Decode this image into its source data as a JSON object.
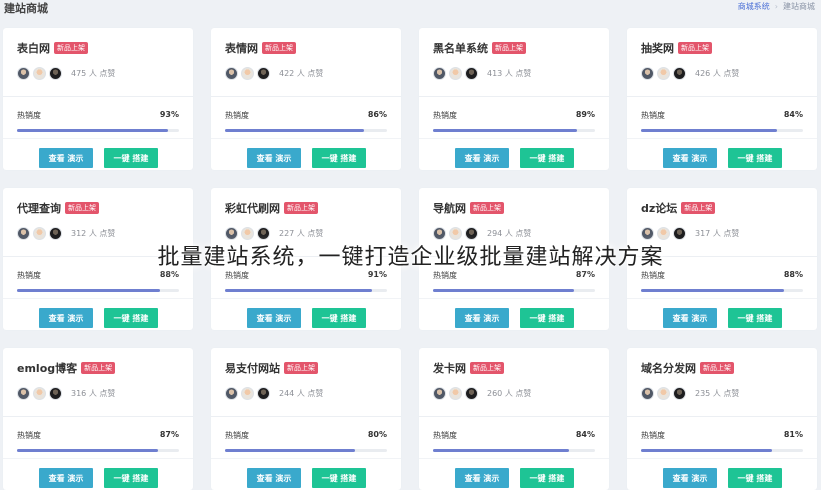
{
  "header": {
    "title": "建站商城",
    "breadcrumb": [
      "商城系统",
      "建站商城"
    ]
  },
  "colors": {
    "badge": "#e3556b",
    "progress": "#6f7fd0",
    "demo_button": "#3aa9cc",
    "build_button": "#1ec495"
  },
  "card_common": {
    "badge": "新品上架",
    "heat_label": "热销度",
    "demo_label": "查看 演示",
    "build_label": "一键 搭建"
  },
  "cards": [
    {
      "title": "表白网",
      "likes": "475 人 点赞",
      "heat": "93%",
      "heat_value": 93
    },
    {
      "title": "表情网",
      "likes": "422 人 点赞",
      "heat": "86%",
      "heat_value": 86
    },
    {
      "title": "黑名单系统",
      "likes": "413 人 点赞",
      "heat": "89%",
      "heat_value": 89
    },
    {
      "title": "抽奖网",
      "likes": "426 人 点赞",
      "heat": "84%",
      "heat_value": 84
    },
    {
      "title": "代理查询",
      "likes": "312 人 点赞",
      "heat": "88%",
      "heat_value": 88
    },
    {
      "title": "彩虹代刷网",
      "likes": "227 人 点赞",
      "heat": "91%",
      "heat_value": 91
    },
    {
      "title": "导航网",
      "likes": "294 人 点赞",
      "heat": "87%",
      "heat_value": 87
    },
    {
      "title": "dz论坛",
      "likes": "317 人 点赞",
      "heat": "88%",
      "heat_value": 88
    },
    {
      "title": "emlog博客",
      "likes": "316 人 点赞",
      "heat": "87%",
      "heat_value": 87
    },
    {
      "title": "易支付网站",
      "likes": "244 人 点赞",
      "heat": "80%",
      "heat_value": 80
    },
    {
      "title": "发卡网",
      "likes": "260 人 点赞",
      "heat": "84%",
      "heat_value": 84
    },
    {
      "title": "域名分发网",
      "likes": "235 人 点赞",
      "heat": "81%",
      "heat_value": 81
    }
  ],
  "overlay": {
    "caption": "批量建站系统，一键打造企业级批量建站解决方案"
  }
}
